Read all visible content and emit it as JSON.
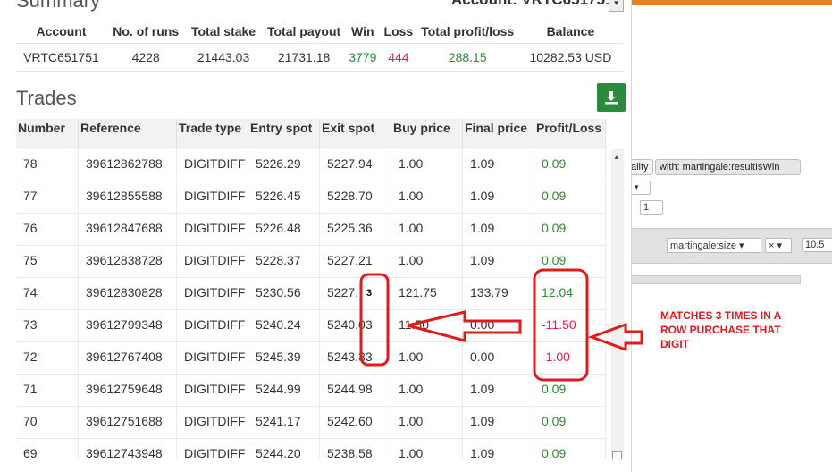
{
  "summary": {
    "title": "Summary",
    "account_label": "Account:",
    "account_value": "VRTC651751",
    "columns": [
      "Account",
      "No. of runs",
      "Total stake",
      "Total payout",
      "Win",
      "Loss",
      "Total profit/loss",
      "Balance"
    ],
    "row": {
      "account": "VRTC651751",
      "runs": "4228",
      "stake": "21443.03",
      "payout": "21731.18",
      "win": "3779",
      "loss": "444",
      "profit": "288.15",
      "balance": "10282.53 USD"
    }
  },
  "trades": {
    "title": "Trades",
    "columns": [
      "Number",
      "Reference",
      "Trade type",
      "Entry spot",
      "Exit spot",
      "Buy price",
      "Final price",
      "Profit/Loss"
    ],
    "rows": [
      {
        "number": "78",
        "reference": "39612862788",
        "type": "DIGITDIFF",
        "entry": "5226.29",
        "exit": "5227.94",
        "buy": "1.00",
        "final": "1.09",
        "pl": "0.09",
        "status": "win"
      },
      {
        "number": "77",
        "reference": "39612855588",
        "type": "DIGITDIFF",
        "entry": "5226.45",
        "exit": "5228.70",
        "buy": "1.00",
        "final": "1.09",
        "pl": "0.09",
        "status": "win"
      },
      {
        "number": "76",
        "reference": "39612847688",
        "type": "DIGITDIFF",
        "entry": "5226.48",
        "exit": "5225.36",
        "buy": "1.00",
        "final": "1.09",
        "pl": "0.09",
        "status": "win"
      },
      {
        "number": "75",
        "reference": "39612838728",
        "type": "DIGITDIFF",
        "entry": "5228.37",
        "exit": "5227.21",
        "buy": "1.00",
        "final": "1.09",
        "pl": "0.09",
        "status": "win"
      },
      {
        "number": "74",
        "reference": "39612830828",
        "type": "DIGITDIFF",
        "entry": "5230.56",
        "exit": "5227.",
        "buy": "121.75",
        "final": "133.79",
        "pl": "12.04",
        "status": "win"
      },
      {
        "number": "73",
        "reference": "39612799348",
        "type": "DIGITDIFF",
        "entry": "5240.24",
        "exit": "5240.03",
        "buy": "11.50",
        "final": "0.00",
        "pl": "-11.50",
        "status": "loss"
      },
      {
        "number": "72",
        "reference": "39612767408",
        "type": "DIGITDIFF",
        "entry": "5245.39",
        "exit": "5243.33",
        "buy": "1.00",
        "final": "0.00",
        "pl": "-1.00",
        "status": "loss"
      },
      {
        "number": "71",
        "reference": "39612759648",
        "type": "DIGITDIFF",
        "entry": "5244.99",
        "exit": "5244.98",
        "buy": "1.00",
        "final": "1.09",
        "pl": "0.09",
        "status": "win"
      },
      {
        "number": "70",
        "reference": "39612751688",
        "type": "DIGITDIFF",
        "entry": "5241.17",
        "exit": "5242.60",
        "buy": "1.00",
        "final": "1.09",
        "pl": "0.09",
        "status": "win"
      },
      {
        "number": "69",
        "reference": "39612743948",
        "type": "DIGITDIFF",
        "entry": "5244.20",
        "exit": "5238.58",
        "buy": "1.00",
        "final": "1.09",
        "pl": "0.09",
        "status": "win"
      }
    ]
  },
  "background_blocks": {
    "chip1": "ality",
    "chip2": "with: martingale:resultIsWin",
    "number1": "1",
    "dropdown1": "martingale:size ▾",
    "dropdown2": "× ▾",
    "number2": "10.5"
  },
  "annotation": {
    "note": "MATCHES 3 TIMES IN A ROW PURCHASE THAT DIGIT",
    "digit": "3",
    "color": "#e21a1a"
  },
  "colors": {
    "win": "#2e8836",
    "loss": "#e31c4b",
    "accent": "#e98024",
    "download": "#2a8b3c"
  }
}
